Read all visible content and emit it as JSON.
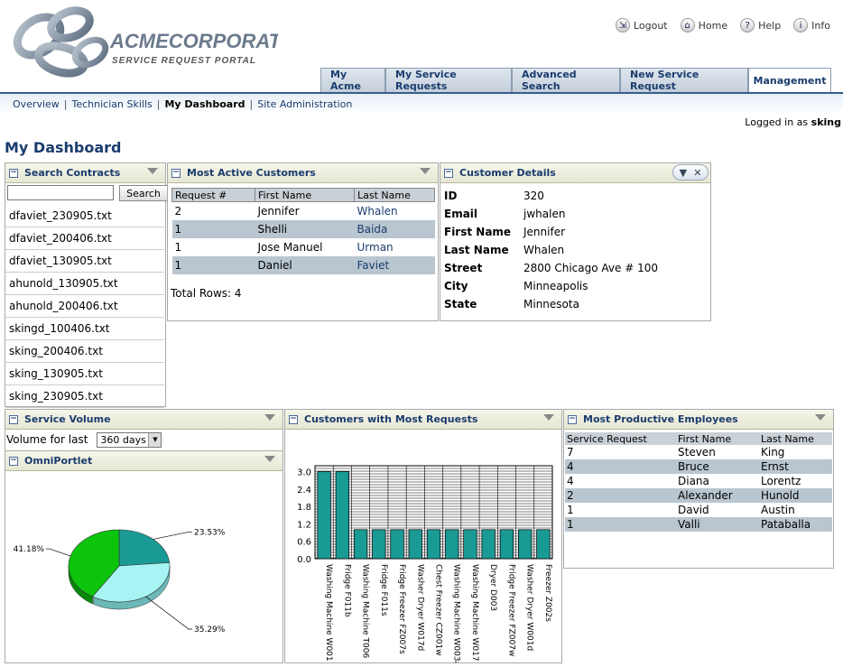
{
  "brand": {
    "name": "ACMECORPORATION",
    "tagline": "SERVICE REQUEST PORTAL"
  },
  "toplinks": [
    {
      "label": "Logout",
      "icon": "logout-icon"
    },
    {
      "label": "Home",
      "icon": "home-icon"
    },
    {
      "label": "Help",
      "icon": "help-icon"
    },
    {
      "label": "Info",
      "icon": "info-icon"
    }
  ],
  "tabs": [
    "My Acme",
    "My Service Requests",
    "Advanced Search",
    "New Service Request",
    "Management"
  ],
  "active_tab": "Management",
  "subnav": [
    "Overview",
    "Technician Skills",
    "My Dashboard",
    "Site Administration"
  ],
  "current_subnav": "My Dashboard",
  "logged_in": {
    "prefix": "Logged in as",
    "user": "sking"
  },
  "page_title": "My Dashboard",
  "search_contracts": {
    "title": "Search Contracts",
    "button": "Search",
    "input_value": "",
    "files": [
      "dfaviet_230905.txt",
      "dfaviet_200406.txt",
      "dfaviet_130905.txt",
      "ahunold_130905.txt",
      "ahunold_200406.txt",
      "skingd_100406.txt",
      "sking_200406.txt",
      "sking_130905.txt",
      "sking_230905.txt"
    ]
  },
  "most_active": {
    "title": "Most Active Customers",
    "columns": [
      "Request #",
      "First Name",
      "Last Name"
    ],
    "rows": [
      [
        "2",
        "Jennifer",
        "Whalen"
      ],
      [
        "1",
        "Shelli",
        "Baida"
      ],
      [
        "1",
        "Jose Manuel",
        "Urman"
      ],
      [
        "1",
        "Daniel",
        "Faviet"
      ]
    ],
    "total": "Total Rows: 4"
  },
  "customer_details": {
    "title": "Customer Details",
    "fields": [
      [
        "ID",
        "320"
      ],
      [
        "Email",
        "jwhalen"
      ],
      [
        "First Name",
        "Jennifer"
      ],
      [
        "Last Name",
        "Whalen"
      ],
      [
        "Street",
        "2800 Chicago Ave # 100"
      ],
      [
        "City",
        "Minneapolis"
      ],
      [
        "State",
        "Minnesota"
      ]
    ]
  },
  "service_volume": {
    "title": "Service Volume",
    "label": "Volume for last",
    "select_value": "360 days"
  },
  "omni": {
    "title": "OmniPortlet",
    "chart_data": {
      "type": "pie",
      "values": [
        23.53,
        35.29,
        41.18
      ],
      "labels": [
        "23.53%",
        "35.29%",
        "41.18%"
      ],
      "colors": [
        "#1a9a94",
        "#a6f4f4",
        "#0cc40c"
      ]
    }
  },
  "customers_requests": {
    "title": "Customers with Most Requests",
    "chart_data": {
      "type": "bar",
      "categories": [
        "Washing Machine W001",
        "Fridge F011b",
        "Washing Machine T006",
        "Fridge F011s",
        "Fridge Freezer FZ007s",
        "Washer Dryer W017d",
        "Chest Freezer CZ001w",
        "Washing Machine W003a",
        "Washing Machine W017",
        "Dryer D003",
        "Fridge Freezer FZ007w",
        "Washer Dryer W001d",
        "Freezer Z002s"
      ],
      "values": [
        3,
        3,
        1,
        1,
        1,
        1,
        1,
        1,
        1,
        1,
        1,
        1,
        1
      ],
      "ylim": [
        0,
        3.2
      ],
      "yticks": [
        "3.0",
        "2.4",
        "1.8",
        "1.2",
        "0.6",
        "0.0"
      ],
      "color": "#1a9a94"
    }
  },
  "productive": {
    "title": "Most Productive Employees",
    "columns": [
      "Service Request",
      "First Name",
      "Last Name"
    ],
    "rows": [
      [
        "7",
        "Steven",
        "King"
      ],
      [
        "4",
        "Bruce",
        "Ernst"
      ],
      [
        "4",
        "Diana",
        "Lorentz"
      ],
      [
        "2",
        "Alexander",
        "Hunold"
      ],
      [
        "1",
        "David",
        "Austin"
      ],
      [
        "1",
        "Valli",
        "Pataballa"
      ]
    ]
  }
}
